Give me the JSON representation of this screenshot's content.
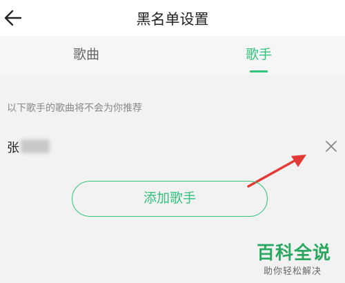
{
  "header": {
    "title": "黑名单设置",
    "back_icon": "back-arrow-icon"
  },
  "tabs": [
    {
      "label": "歌曲",
      "active": false
    },
    {
      "label": "歌手",
      "active": true
    }
  ],
  "accent_color": "#31c27c",
  "hint_text": "以下歌手的歌曲将不会为你推荐",
  "singers": [
    {
      "name_visible": "张",
      "remove_icon": "close-icon"
    }
  ],
  "add_button_label": "添加歌手",
  "watermark": {
    "title": "百科全说",
    "subtitle": "助你轻松解决"
  }
}
